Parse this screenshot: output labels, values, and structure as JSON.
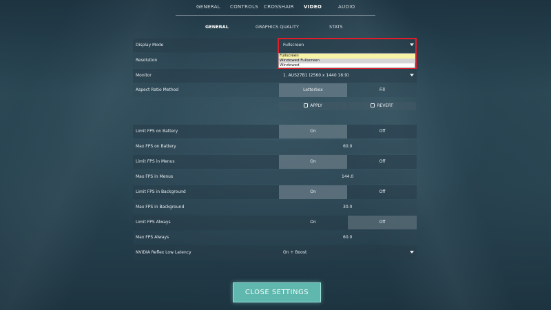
{
  "top_tabs": [
    "GENERAL",
    "CONTROLS",
    "CROSSHAIR",
    "VIDEO",
    "AUDIO"
  ],
  "active_top_tab": "VIDEO",
  "sub_tabs": [
    "GENERAL",
    "GRAPHICS QUALITY",
    "STATS"
  ],
  "active_sub_tab": "GENERAL",
  "display_mode": {
    "label": "Display Mode",
    "value": "Fullscreen",
    "options": [
      "Fullscreen",
      "Windowed Fullscreen",
      "Windowed"
    ],
    "highlighted_option": "Windowed Fullscreen"
  },
  "resolution_label": "Resolution",
  "monitor": {
    "label": "Monitor",
    "value": "1. AUS27B1 (2560 x 1440 16:9)"
  },
  "aspect_ratio": {
    "label": "Aspect Ratio Method",
    "options": [
      "Letterbox",
      "Fill"
    ],
    "selected": "Letterbox"
  },
  "apply_label": "APPLY",
  "revert_label": "REVERT",
  "settings": [
    {
      "label": "Limit FPS on Battery",
      "type": "toggle",
      "on": "On",
      "off": "Off",
      "selected": "On"
    },
    {
      "label": "Max FPS on Battery",
      "type": "value",
      "value": "60.0"
    },
    {
      "label": "Limit FPS in Menus",
      "type": "toggle",
      "on": "On",
      "off": "Off",
      "selected": "On"
    },
    {
      "label": "Max FPS in Menus",
      "type": "value",
      "value": "144.0"
    },
    {
      "label": "Limit FPS in Background",
      "type": "toggle",
      "on": "On",
      "off": "Off",
      "selected": "On"
    },
    {
      "label": "Max FPS in Background",
      "type": "value",
      "value": "30.0"
    },
    {
      "label": "Limit FPS Always",
      "type": "toggle",
      "on": "On",
      "off": "Off",
      "selected": "Off"
    },
    {
      "label": "Max FPS Always",
      "type": "value",
      "value": "60.0"
    }
  ],
  "nvidia_reflex": {
    "label": "NVIDIA Reflex Low Latency",
    "value": "On + Boost"
  },
  "close_button": "CLOSE SETTINGS",
  "colors": {
    "highlight_border": "#e11d2a",
    "close_button": "#5fb7ae"
  }
}
